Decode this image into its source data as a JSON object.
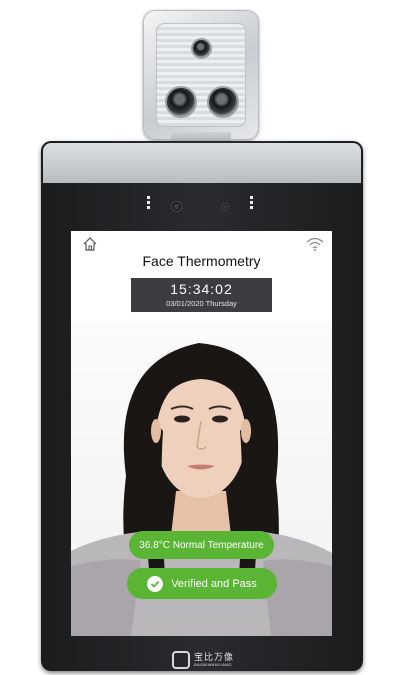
{
  "screen": {
    "title": "Face Thermometry",
    "clock": {
      "time": "15:34:02",
      "date": "03/01/2020 Thursday"
    },
    "icons": {
      "home": "home-icon",
      "wifi": "wifi-icon"
    },
    "result": {
      "temperature_text": "36.8°C  Normal Temperature",
      "verification_text": "Verified and Pass",
      "status_color": "#5ab534"
    }
  },
  "brand": {
    "name_cn": "宝比万像",
    "name_en": "BAOBIWANXIANG"
  }
}
